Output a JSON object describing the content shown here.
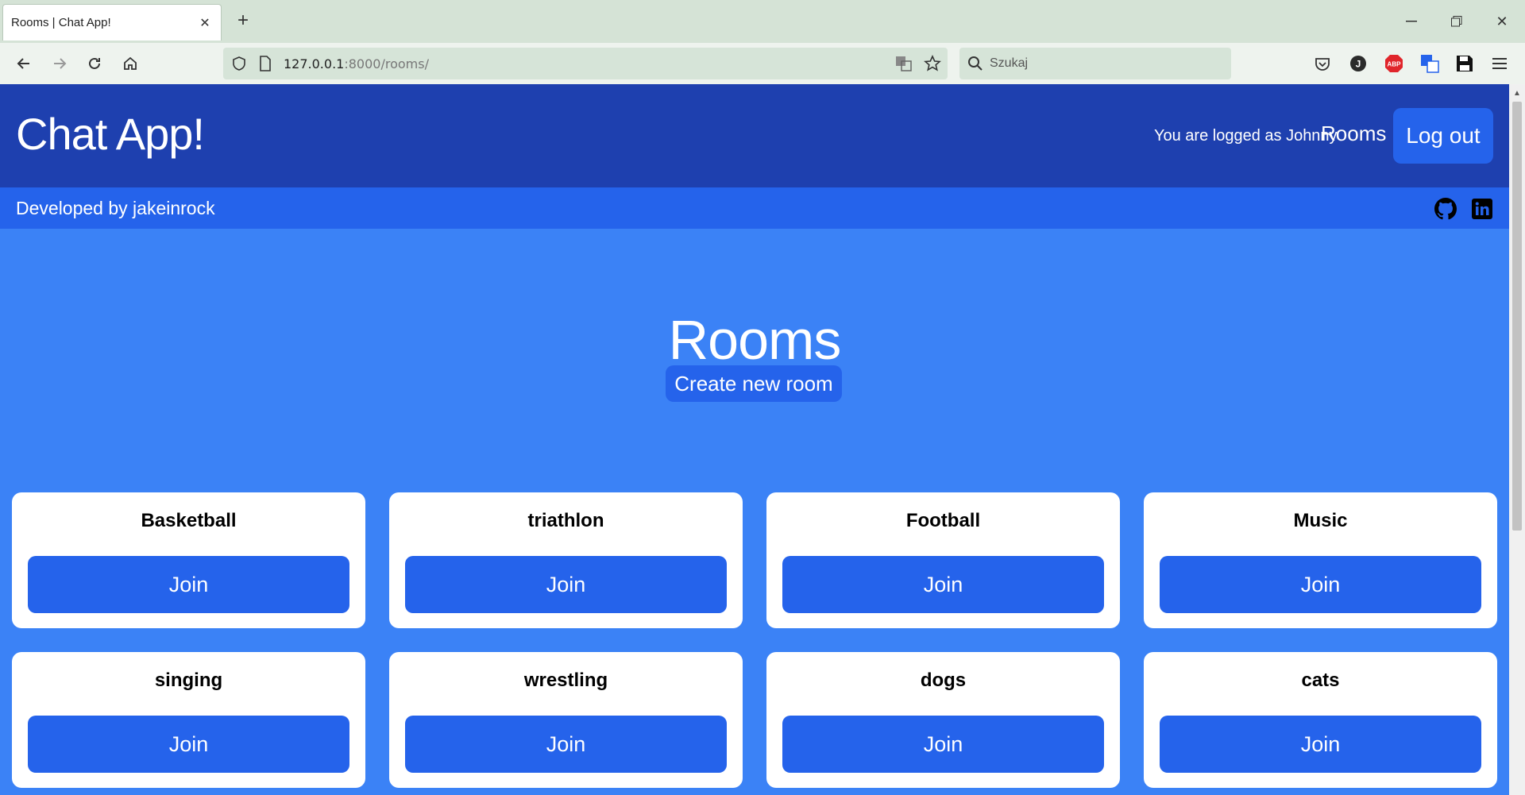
{
  "browser": {
    "tab_title": "Rooms | Chat App!",
    "url_host": "127.0.0.1",
    "url_rest": ":8000/rooms/",
    "search_placeholder": "Szukaj",
    "ext_profile_letter": "J",
    "ext_abp_label": "ABP"
  },
  "header": {
    "title": "Chat App!",
    "logged_text": "You are logged as Johnny",
    "rooms_link": "Rooms",
    "logout_label": "Log out"
  },
  "subbar": {
    "developer_text": "Developed by jakeinrock"
  },
  "main": {
    "heading": "Rooms",
    "create_label": "Create new room"
  },
  "rooms": [
    {
      "name": "Basketball",
      "join_label": "Join"
    },
    {
      "name": "triathlon",
      "join_label": "Join"
    },
    {
      "name": "Football",
      "join_label": "Join"
    },
    {
      "name": "Music",
      "join_label": "Join"
    },
    {
      "name": "singing",
      "join_label": "Join"
    },
    {
      "name": "wrestling",
      "join_label": "Join"
    },
    {
      "name": "dogs",
      "join_label": "Join"
    },
    {
      "name": "cats",
      "join_label": "Join"
    }
  ],
  "colors": {
    "header_bg": "#1e40af",
    "subbar_bg": "#2563eb",
    "page_bg": "#3b82f6",
    "button_bg": "#2563eb"
  }
}
